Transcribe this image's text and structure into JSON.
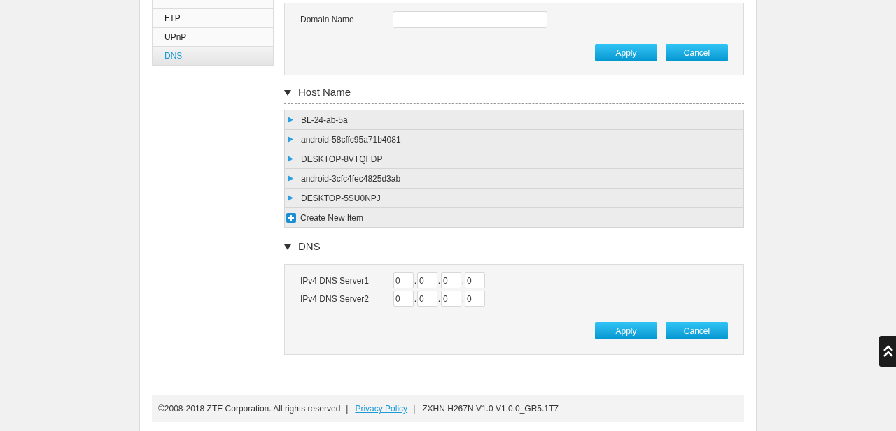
{
  "sidebar": {
    "items": [
      {
        "label": "FTP",
        "selected": false
      },
      {
        "label": "UPnP",
        "selected": false
      },
      {
        "label": "DNS",
        "selected": true
      }
    ]
  },
  "domain_panel": {
    "label": "Domain Name",
    "buttons": [
      "Apply",
      "Cancel"
    ]
  },
  "host_name": {
    "title": "Host Name",
    "expanded": true,
    "items": [
      {
        "label": "BL-24-ab-5a"
      },
      {
        "label": "android-58cffc95a71b4081"
      },
      {
        "label": "DESKTOP-8VTQFDP"
      },
      {
        "label": "android-3cfc4fec4825d3ab"
      },
      {
        "label": "DESKTOP-5SU0NPJ"
      }
    ],
    "create_label": "Create New Item"
  },
  "dns": {
    "title": "DNS",
    "expanded": true,
    "octet_separator": ".",
    "servers": [
      {
        "label": "IPv4 DNS Server1",
        "octets": [
          "0",
          "0",
          "0",
          "0"
        ]
      },
      {
        "label": "IPv4 DNS Server2",
        "octets": [
          "0",
          "0",
          "0",
          "0"
        ]
      }
    ],
    "buttons": [
      "Apply",
      "Cancel"
    ]
  },
  "footer": {
    "copyright": "©2008-2018 ZTE Corporation. All rights reserved",
    "separator_1": "|",
    "link": "Privacy Policy",
    "separator_2": "|",
    "version": "ZXHN H267N V1.0 V1.0.0_GR5.1T7"
  }
}
